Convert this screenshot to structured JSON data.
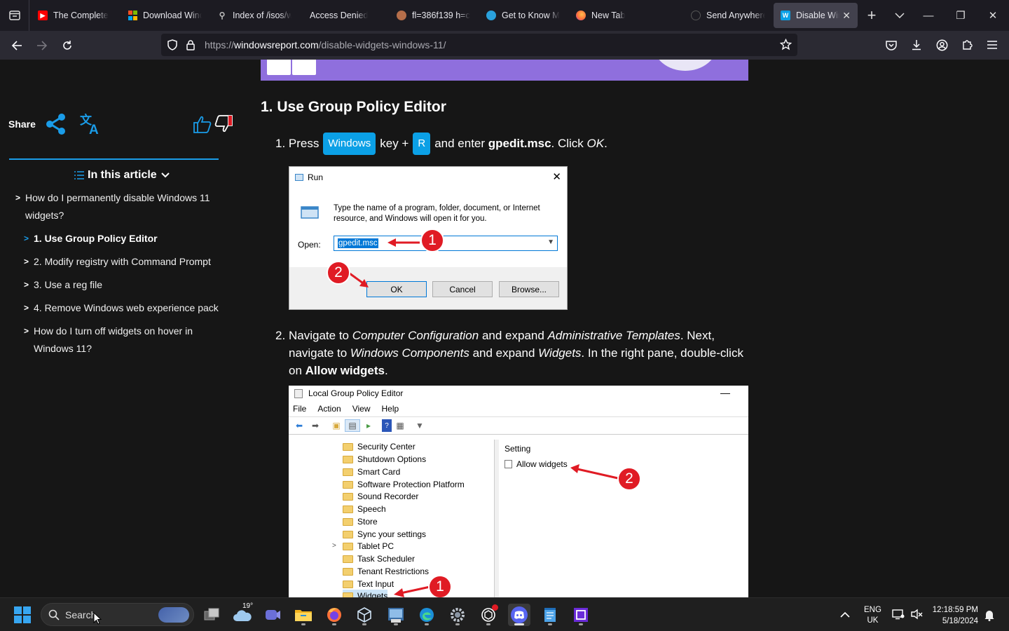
{
  "browser": {
    "tabs": [
      {
        "label": "The Complete",
        "favicon": "youtube-icon",
        "color": "#ff0000"
      },
      {
        "label": "Download Windows",
        "favicon": "microsoft-icon",
        "color": "#f25022"
      },
      {
        "label": "Index of /isos/w",
        "favicon": "archive-icon",
        "color": "#888888"
      },
      {
        "label": "Access Denied",
        "favicon": "",
        "color": ""
      },
      {
        "label": "fl=386f139 h=c",
        "favicon": "cloudflare-icon",
        "color": "#f38020"
      },
      {
        "label": "Get to Know M",
        "favicon": "edge-icon",
        "color": "#2aa1dc"
      },
      {
        "label": "New Tab",
        "favicon": "firefox-icon",
        "color": "#ff7139"
      },
      {
        "label": "Send Anywhere",
        "favicon": "sendanywhere-icon",
        "color": "#555555"
      },
      {
        "label": "Disable Wind",
        "favicon": "windowsreport-icon",
        "color": "#0ba0e6",
        "active": true
      }
    ],
    "url_scheme": "https://",
    "url_host": "windowsreport.com",
    "url_path": "/disable-widgets-windows-11/"
  },
  "sidebar": {
    "share_label": "Share",
    "toc_title": "In this article",
    "toc": [
      {
        "label": "How do I permanently disable Windows 11 widgets?",
        "level": 0
      },
      {
        "label": "1. Use Group Policy Editor",
        "level": 1,
        "active": true
      },
      {
        "label": "2. Modify registry with Command Prompt",
        "level": 1
      },
      {
        "label": "3. Use a reg file",
        "level": 1
      },
      {
        "label": "4. Remove Windows web experience pack",
        "level": 1
      },
      {
        "label": "How do I turn off widgets on hover in Windows 11?",
        "level": 1
      }
    ]
  },
  "article": {
    "heading": "1. Use Group Policy Editor",
    "step1": {
      "num": "1.",
      "t1": "Press",
      "key1": "Windows",
      "t2": "key +",
      "key2": "R",
      "t3": "and enter",
      "cmd": "gpedit.msc",
      "t4": ". Click",
      "ok": "OK",
      "t5": "."
    },
    "step2": {
      "num": "2.",
      "a": "Navigate to ",
      "b": "Computer Configuration",
      "c": " and expand ",
      "d": "Administrative Templates",
      "e": ". Next, navigate to ",
      "f": "Windows Components",
      "g": " and expand ",
      "h": "Widgets",
      "i": ". In the right pane, double-click on ",
      "j": "Allow widgets",
      "k": "."
    }
  },
  "run_dialog": {
    "title": "Run",
    "description": "Type the name of a program, folder, document, or Internet resource, and Windows will open it for you.",
    "open_label": "Open:",
    "value": "gpedit.msc",
    "ok": "OK",
    "cancel": "Cancel",
    "browse": "Browse...",
    "badge1": "1",
    "badge2": "2"
  },
  "gpe": {
    "title": "Local Group Policy Editor",
    "menu": [
      "File",
      "Action",
      "View",
      "Help"
    ],
    "tree": [
      "Security Center",
      "Shutdown Options",
      "Smart Card",
      "Software Protection Platform",
      "Sound Recorder",
      "Speech",
      "Store",
      "Sync your settings",
      "Tablet PC",
      "Task Scheduler",
      "Tenant Restrictions",
      "Text Input",
      "Widgets"
    ],
    "setting_header": "Setting",
    "setting_item": "Allow widgets",
    "badge1": "1",
    "badge2": "2"
  },
  "taskbar": {
    "search": "Search",
    "weather": "19°",
    "lang1": "ENG",
    "lang2": "UK",
    "time": "12:18:59 PM",
    "date": "5/18/2024"
  }
}
